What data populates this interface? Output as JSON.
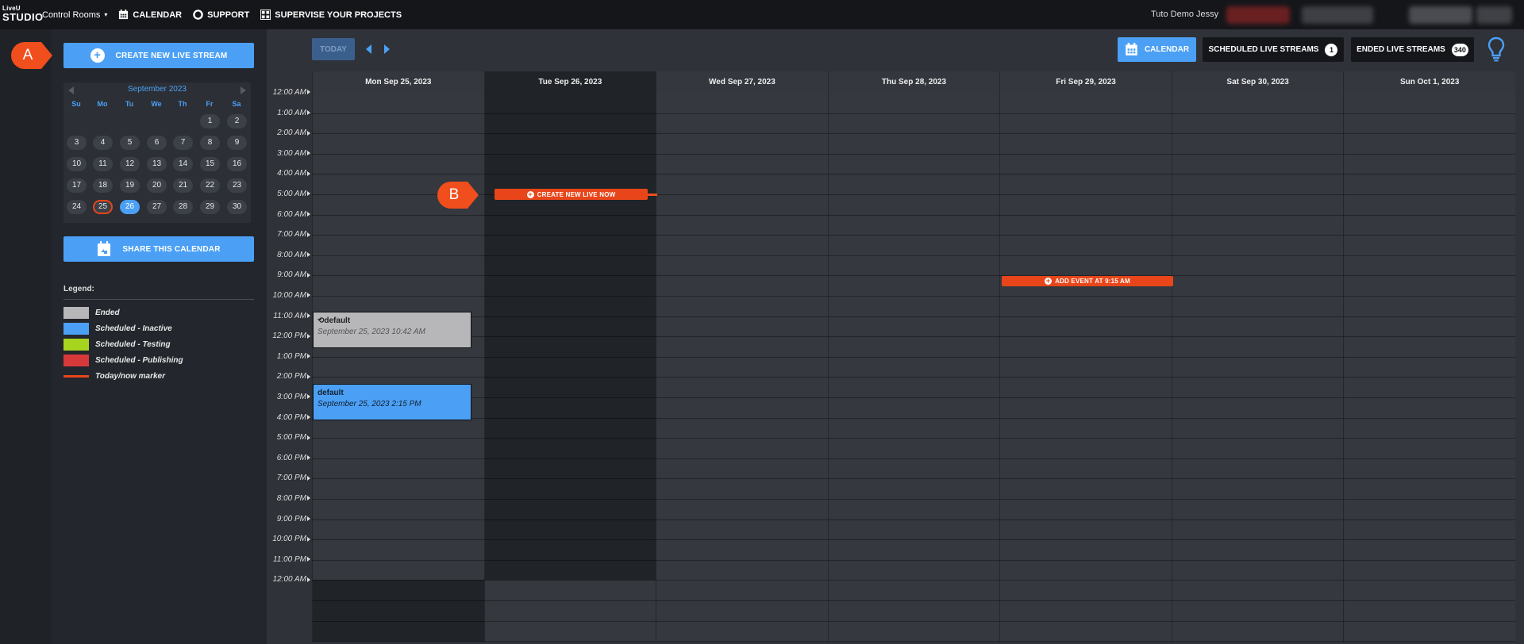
{
  "brand": {
    "line1": "LiveU",
    "line2": "STUDIO"
  },
  "topnav": {
    "control_rooms": "Control Rooms",
    "calendar": "CALENDAR",
    "support": "SUPPORT",
    "supervise": "SUPERVISE YOUR PROJECTS"
  },
  "user": {
    "name": "Tuto Demo Jessy"
  },
  "sidebar": {
    "create_button": "CREATE NEW LIVE STREAM",
    "share_button": "SHARE THIS CALENDAR",
    "mini_calendar": {
      "month": "September 2023",
      "weekdays": [
        "Su",
        "Mo",
        "Tu",
        "We",
        "Th",
        "Fr",
        "Sa"
      ],
      "days": [
        "1",
        "2",
        "3",
        "4",
        "5",
        "6",
        "7",
        "8",
        "9",
        "10",
        "11",
        "12",
        "13",
        "14",
        "15",
        "16",
        "17",
        "18",
        "19",
        "20",
        "21",
        "22",
        "23",
        "24",
        "25",
        "26",
        "27",
        "28",
        "29",
        "30"
      ],
      "first_weekday_index": 5,
      "selected_day": "25",
      "today_day": "26"
    },
    "legend": {
      "title": "Legend:",
      "items": [
        {
          "label": "Ended",
          "color": "#b7b7b9"
        },
        {
          "label": "Scheduled - Inactive",
          "color": "#4ba0f5"
        },
        {
          "label": "Scheduled - Testing",
          "color": "#a7d41e"
        },
        {
          "label": "Scheduled - Publishing",
          "color": "#d7393a"
        },
        {
          "label": "Today/now marker",
          "color": "#e8461a"
        }
      ]
    }
  },
  "toolbar": {
    "today": "TODAY",
    "calendar": "CALENDAR",
    "scheduled": "SCHEDULED LIVE STREAMS",
    "scheduled_count": "1",
    "ended": "ENDED LIVE STREAMS",
    "ended_count": "340"
  },
  "week": {
    "columns": [
      "Mon Sep 25, 2023",
      "Tue Sep 26, 2023",
      "Wed Sep 27, 2023",
      "Thu Sep 28, 2023",
      "Fri Sep 29, 2023",
      "Sat Sep 30, 2023",
      "Sun Oct 1, 2023"
    ],
    "today_index": 1,
    "hours": [
      "12:00 AM",
      "1:00 AM",
      "2:00 AM",
      "3:00 AM",
      "4:00 AM",
      "5:00 AM",
      "6:00 AM",
      "7:00 AM",
      "8:00 AM",
      "9:00 AM",
      "10:00 AM",
      "11:00 AM",
      "12:00 PM",
      "1:00 PM",
      "2:00 PM",
      "3:00 PM",
      "4:00 PM",
      "5:00 PM",
      "6:00 PM",
      "7:00 PM",
      "8:00 PM",
      "9:00 PM",
      "10:00 PM",
      "11:00 PM",
      "12:00 AM"
    ]
  },
  "events": [
    {
      "title": "default",
      "subtitle": "September 25, 2023 10:42 AM",
      "status": "Ended",
      "day": "Mon Sep 25, 2023"
    },
    {
      "title": "default",
      "subtitle": "September 25, 2023 2:15 PM",
      "status": "Scheduled - Inactive",
      "day": "Mon Sep 25, 2023"
    }
  ],
  "actions": {
    "create_now": "CREATE NEW LIVE NOW",
    "add_event": "ADD EVENT AT 9:15 AM"
  },
  "callouts": {
    "a": "A",
    "b": "B"
  },
  "colors": {
    "accent": "#4ba0f5",
    "marker": "#e8461a",
    "callout": "#f04e1c"
  }
}
